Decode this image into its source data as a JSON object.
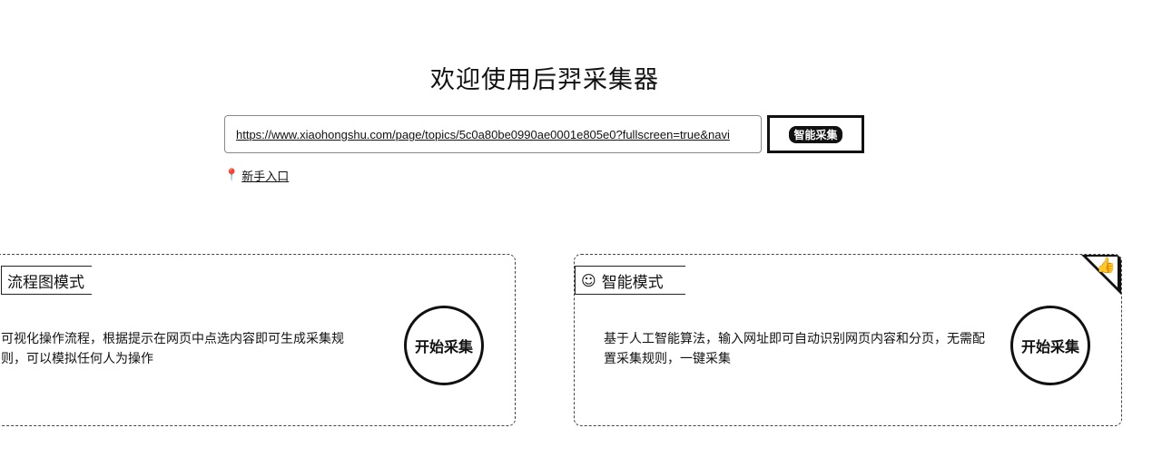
{
  "title": "欢迎使用后羿采集器",
  "search": {
    "value": "https://www.xiaohongshu.com/page/topics/5c0a80be0990ae0001e805e0?fullscreen=true&navi",
    "smart_button": "智能采集"
  },
  "newbie_link": "新手入口",
  "cards": [
    {
      "tag": "流程图模式",
      "description": "可视化操作流程，根据提示在网页中点选内容即可生成采集规则，可以模拟任何人为操作",
      "button": "开始采集"
    },
    {
      "tag": "智能模式",
      "description": "基于人工智能算法，输入网址即可自动识别网页内容和分页，无需配置采集规则，一键采集",
      "button": "开始采集"
    }
  ]
}
